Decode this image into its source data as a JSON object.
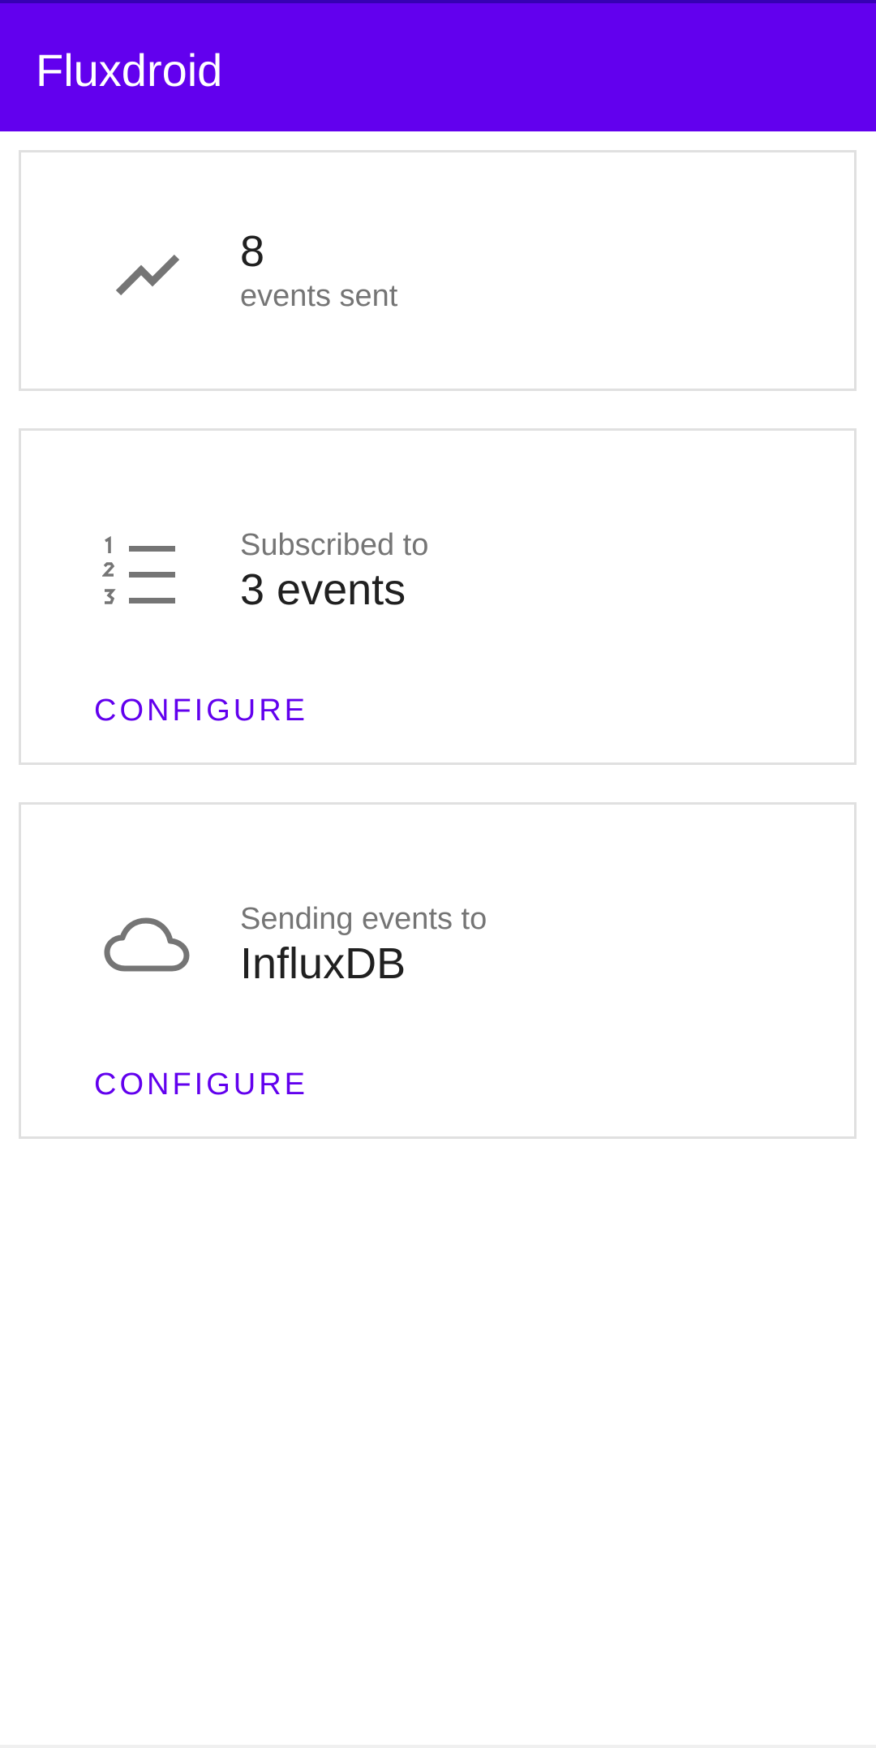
{
  "app_bar": {
    "title": "Fluxdroid",
    "color": "#6200EE"
  },
  "events_card": {
    "icon": "trending-up-icon",
    "count": "8",
    "label": "events sent"
  },
  "subscriptions_card": {
    "icon": "numbered-list-icon",
    "caption": "Subscribed to",
    "value": "3 events",
    "action_label": "CONFIGURE"
  },
  "destination_card": {
    "icon": "cloud-icon",
    "caption": "Sending events to",
    "value": "InfluxDB",
    "action_label": "CONFIGURE"
  },
  "colors": {
    "accent": "#6200EE",
    "icon": "#757575"
  }
}
